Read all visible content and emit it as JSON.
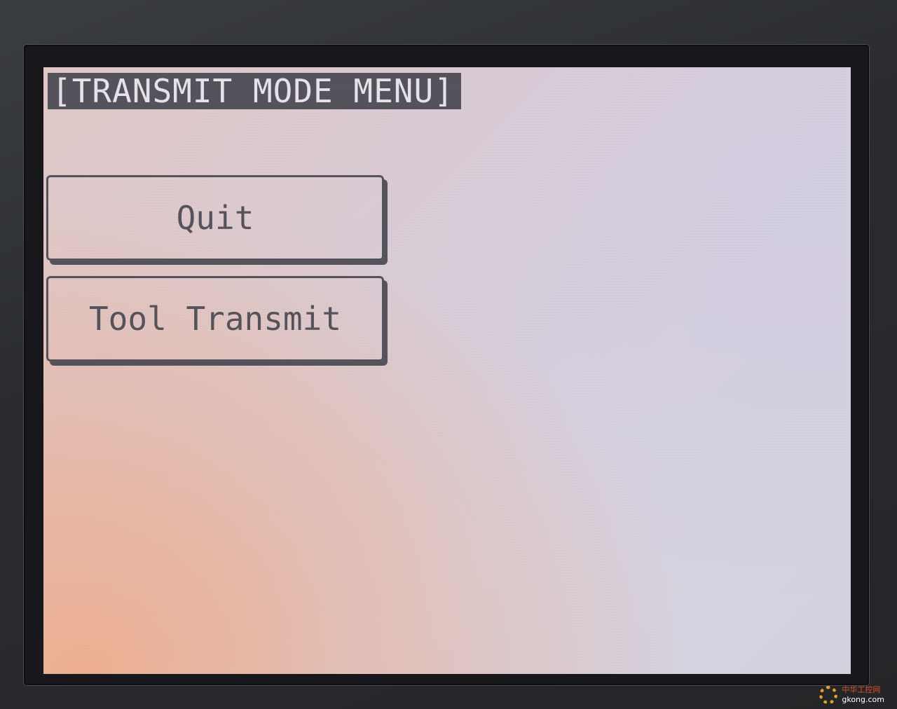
{
  "screen": {
    "title": "[TRANSMIT MODE MENU]",
    "buttons": [
      {
        "label": "Quit"
      },
      {
        "label": "Tool Transmit"
      }
    ]
  },
  "watermark": {
    "name": "中华工控网",
    "url": "gkong.com",
    "icon": "gear-icon"
  },
  "colors": {
    "lcd_ink": "#55545c",
    "lcd_background": "#ddd0d6",
    "watermark": "#e5a020"
  }
}
